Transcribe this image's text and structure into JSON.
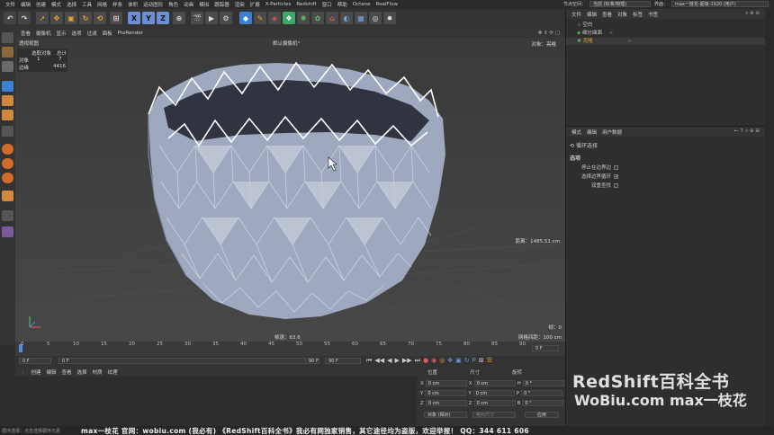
{
  "app": {
    "menu": [
      "文件",
      "编辑",
      "创建",
      "模式",
      "选择",
      "工具",
      "网格",
      "样条",
      "体积",
      "运动图形",
      "角色",
      "动画",
      "模拟",
      "跟踪器",
      "渲染",
      "扩展",
      "X-Particles",
      "Redshift",
      "窗口",
      "帮助",
      "Octane",
      "RealFlow"
    ],
    "node_space_label": "节点空间：",
    "node_space_value": "当前 (标准/物理)",
    "layout_label": "界面：",
    "layout_value": "max一枝花-超级-1920 (用户)"
  },
  "viewport": {
    "menu": [
      "查看",
      "摄像机",
      "显示",
      "选项",
      "过滤",
      "面板",
      "ProRender"
    ],
    "view_name": "透视视图",
    "camera_name": "默认摄像机°",
    "object_label": "对象：亮格",
    "stats_headers": [
      "选取对象",
      "总计"
    ],
    "stats_rows": [
      {
        "label": "对象",
        "selected": "1",
        "total": "7"
      },
      {
        "label": "边缘",
        "selected": "",
        "total": "4416"
      }
    ],
    "distance": "距离：1485.51 cm",
    "frame": "帧：0",
    "grid": "网格间距：100 cm",
    "fps": "帧速：63.6"
  },
  "timeline": {
    "ticks": [
      "0",
      "5",
      "10",
      "15",
      "20",
      "25",
      "30",
      "35",
      "40",
      "45",
      "50",
      "55",
      "60",
      "65",
      "70",
      "75",
      "80",
      "85",
      "90"
    ],
    "end_frame": "0 F"
  },
  "playbar": {
    "start": "0 F",
    "start2": "0 F",
    "end": "90 F",
    "end2": "90 F"
  },
  "material_panel": {
    "menu": [
      "创建",
      "编辑",
      "查看",
      "选择",
      "材质",
      "纹理"
    ]
  },
  "coord_panel": {
    "headers": [
      "位置",
      "尺寸",
      "旋转"
    ],
    "rows": [
      {
        "axis": "X",
        "pos": "0 cm",
        "size_axis": "X",
        "size": "0 cm",
        "rot_axis": "H",
        "rot": "0 °"
      },
      {
        "axis": "Y",
        "pos": "0 cm",
        "size_axis": "Y",
        "size": "0 cm",
        "rot_axis": "P",
        "rot": "0 °"
      },
      {
        "axis": "Z",
        "pos": "0 cm",
        "size_axis": "Z",
        "size": "0 cm",
        "rot_axis": "B",
        "rot": "0 °"
      }
    ],
    "mode_select": "对象 (相对)",
    "size_select": "绝对尺寸",
    "apply": "应用"
  },
  "object_manager": {
    "menu": [
      "文件",
      "编辑",
      "查看",
      "对象",
      "标签",
      "书签"
    ],
    "items": [
      {
        "name": "空白",
        "color": "#d8d8d8"
      },
      {
        "name": "细分曲面",
        "color": "#d8d8d8"
      },
      {
        "name": "克隆",
        "color": "#e0a03c"
      }
    ]
  },
  "attribute_manager": {
    "menu": [
      "模式",
      "编辑",
      "用户数据"
    ],
    "tool_title": "循环选择",
    "section": "选项",
    "options": [
      {
        "label": "停止在边界边",
        "checked": false
      },
      {
        "label": "选择边界循环",
        "checked": true
      },
      {
        "label": "双重查找",
        "checked": false
      }
    ]
  },
  "status": {
    "left": "循环选择：点击选择循环元素",
    "credit": "max一枝花 官网：wobiu.com (我必有) 《RedShift百科全书》我必有网独家销售，其它途径均为盗版，欢迎举报！  QQ：344 611 606"
  },
  "watermark": {
    "line1": "RedShift百科全书",
    "line2": "WoBiu.com  max一枝花"
  }
}
